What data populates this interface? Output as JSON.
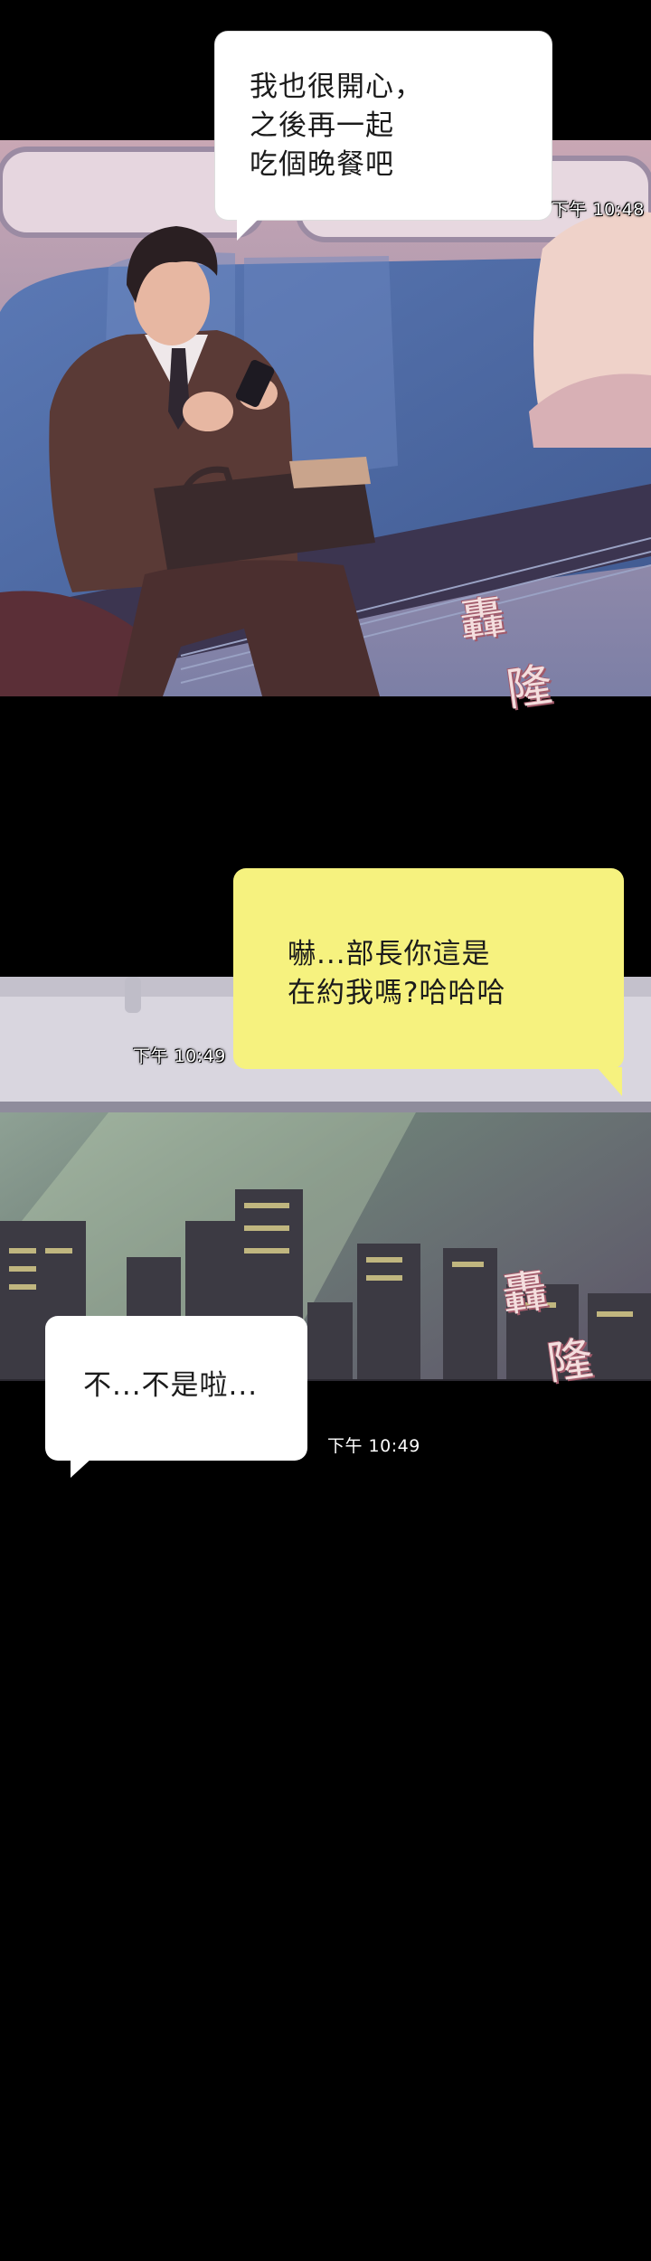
{
  "panel1": {
    "bubble_lines": [
      "我也很開心，",
      "之後再一起",
      "吃個晚餐吧"
    ],
    "timestamp": "下午 10:48",
    "sfx": [
      "轟",
      "隆"
    ]
  },
  "panel2": {
    "bubble_lines": [
      "嚇...部長你這是",
      "在約我嗎?哈哈哈"
    ],
    "timestamp": "下午 10:49",
    "sfx": [
      "轟",
      "隆"
    ]
  },
  "panel3": {
    "bubble_lines": [
      "不...不是啦..."
    ],
    "timestamp": "下午 10:49"
  },
  "colors": {
    "background": "#000000",
    "bubble_white": "#ffffff",
    "bubble_yellow": "#f6f27f",
    "seat_blue": "#4f6ea8",
    "suit_brown": "#5a3a36"
  }
}
